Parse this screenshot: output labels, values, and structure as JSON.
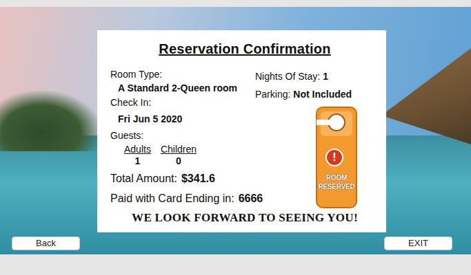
{
  "reservation": {
    "title": "Reservation Confirmation",
    "room_type_label": "Room Type:",
    "room_type": "A Standard 2-Queen room",
    "check_in_label": "Check In:",
    "check_in": "Fri Jun 5 2020",
    "guests_label": "Guests:",
    "guests": [
      {
        "label": "Adults",
        "count": "1"
      },
      {
        "label": "Children",
        "count": "0"
      }
    ],
    "total_label": "Total Amount:",
    "total": "$341.6",
    "card_label": "Paid with Card Ending in:",
    "card": "6666",
    "nights_label": "Nights Of Stay:",
    "nights": "1",
    "parking_label": "Parking:",
    "parking": "Not Included",
    "sign": {
      "mark": "!",
      "lines": [
        "ROOM",
        "RESERVED"
      ]
    },
    "footer": "WE LOOK FORWARD TO SEEING YOU!"
  },
  "buttons": [
    {
      "label": "Back"
    },
    {
      "label": "EXIT"
    }
  ]
}
